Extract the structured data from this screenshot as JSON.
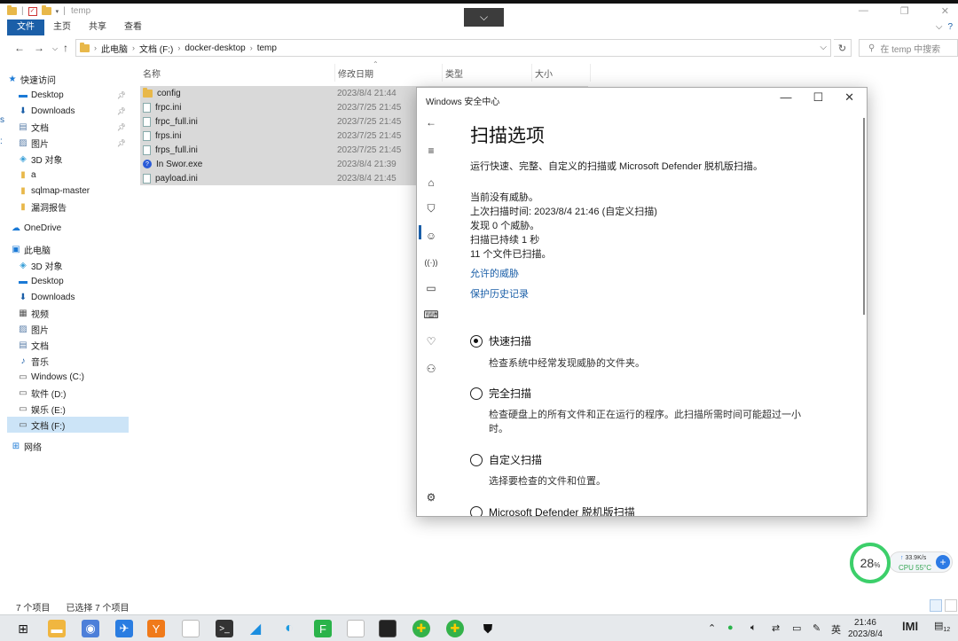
{
  "explorer": {
    "title": "temp",
    "ribbon_tabs": [
      "文件",
      "主页",
      "共享",
      "查看"
    ],
    "breadcrumb": [
      "此电脑",
      "文档 (F:)",
      "docker-desktop",
      "temp"
    ],
    "search_placeholder": "在 temp 中搜索",
    "nav": {
      "quick_access": "快速访问",
      "quick_items": [
        {
          "label": "Desktop",
          "icon": "desktop-icon",
          "pinned": true
        },
        {
          "label": "Downloads",
          "icon": "download-icon",
          "pinned": true
        },
        {
          "label": "文档",
          "icon": "document-icon",
          "pinned": true
        },
        {
          "label": "图片",
          "icon": "picture-icon",
          "pinned": true
        },
        {
          "label": "3D 对象",
          "icon": "cube-icon",
          "pinned": false
        },
        {
          "label": "a",
          "icon": "folder-icon",
          "pinned": false
        },
        {
          "label": "sqlmap-master",
          "icon": "folder-icon",
          "pinned": false
        },
        {
          "label": "漏洞报告",
          "icon": "folder-icon",
          "pinned": false
        }
      ],
      "onedrive": "OneDrive",
      "this_pc": "此电脑",
      "pc_items": [
        {
          "label": "3D 对象",
          "icon": "cube-icon"
        },
        {
          "label": "Desktop",
          "icon": "desktop-icon"
        },
        {
          "label": "Downloads",
          "icon": "download-icon"
        },
        {
          "label": "视频",
          "icon": "video-icon"
        },
        {
          "label": "图片",
          "icon": "picture-icon"
        },
        {
          "label": "文档",
          "icon": "document-icon"
        },
        {
          "label": "音乐",
          "icon": "music-icon"
        },
        {
          "label": "Windows (C:)",
          "icon": "drive-icon"
        },
        {
          "label": "软件 (D:)",
          "icon": "drive-icon"
        },
        {
          "label": "娱乐 (E:)",
          "icon": "drive-icon"
        },
        {
          "label": "文档 (F:)",
          "icon": "drive-icon",
          "selected": true
        }
      ],
      "network": "网络"
    },
    "columns": [
      "名称",
      "修改日期",
      "类型",
      "大小"
    ],
    "files": [
      {
        "name": "config",
        "date": "2023/8/4 21:44",
        "kind": "folder"
      },
      {
        "name": "frpc.ini",
        "date": "2023/7/25 21:45",
        "kind": "file"
      },
      {
        "name": "frpc_full.ini",
        "date": "2023/7/25 21:45",
        "kind": "file"
      },
      {
        "name": "frps.ini",
        "date": "2023/7/25 21:45",
        "kind": "file"
      },
      {
        "name": "frps_full.ini",
        "date": "2023/7/25 21:45",
        "kind": "file"
      },
      {
        "name": "In Swor.exe",
        "date": "2023/8/4 21:39",
        "kind": "exe"
      },
      {
        "name": "payload.ini",
        "date": "2023/8/4 21:45",
        "kind": "file"
      }
    ],
    "status_count": "7 个项目",
    "status_selected": "已选择 7 个项目"
  },
  "defender": {
    "window_title": "Windows 安全中心",
    "heading": "扫描选项",
    "subtitle": "运行快速、完整、自定义的扫描或 Microsoft Defender 脱机版扫描。",
    "info_lines": [
      "当前没有威胁。",
      "上次扫描时间: 2023/8/4 21:46 (自定义扫描)",
      "发现 0 个威胁。",
      "扫描已持续 1 秒",
      "11 个文件已扫描。"
    ],
    "link_allowed": "允许的威胁",
    "link_history": "保护历史记录",
    "options": [
      {
        "label": "快速扫描",
        "desc": "检查系统中经常发现威胁的文件夹。",
        "selected": true
      },
      {
        "label": "完全扫描",
        "desc": "检查硬盘上的所有文件和正在运行的程序。此扫描所需时间可能超过一小时。",
        "selected": false
      },
      {
        "label": "自定义扫描",
        "desc": "选择要检查的文件和位置。",
        "selected": false
      },
      {
        "label": "Microsoft Defender 脱机版扫描",
        "desc": "",
        "selected": false
      }
    ]
  },
  "monitor": {
    "percent": "28",
    "percent_unit": "%",
    "net": "33.9K/s",
    "cpu": "CPU 55°C",
    "ring_color": "#3ccf6a"
  },
  "taskbar": {
    "ime": "英",
    "time": "21:46",
    "date": "2023/8/4",
    "notif_count": "12"
  }
}
